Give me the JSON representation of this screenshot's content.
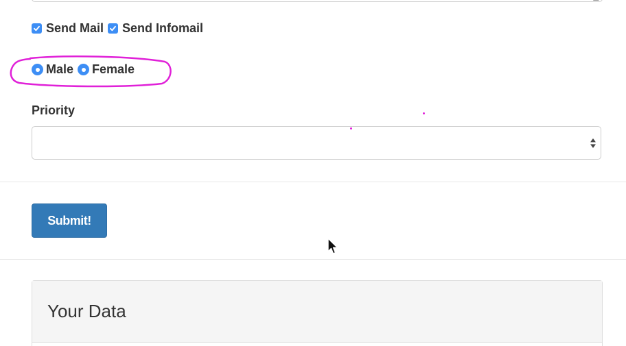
{
  "form": {
    "checkboxes": [
      {
        "label": "Send Mail",
        "checked": true
      },
      {
        "label": "Send Infomail",
        "checked": true
      }
    ],
    "radios": [
      {
        "label": "Male",
        "selected": true
      },
      {
        "label": "Female",
        "selected": true
      }
    ],
    "priority": {
      "label": "Priority",
      "selected_value": ""
    },
    "submit_label": "Submit!"
  },
  "panel": {
    "heading": "Your Data"
  },
  "colors": {
    "accent": "#3d8ef5",
    "primary_button": "#337ab7",
    "annotation": "#e020d8"
  },
  "icons": {
    "checkbox": "check-icon",
    "radio": "radio-dot-icon",
    "select": "select-arrows-icon",
    "cursor": "mouse-pointer-icon"
  }
}
